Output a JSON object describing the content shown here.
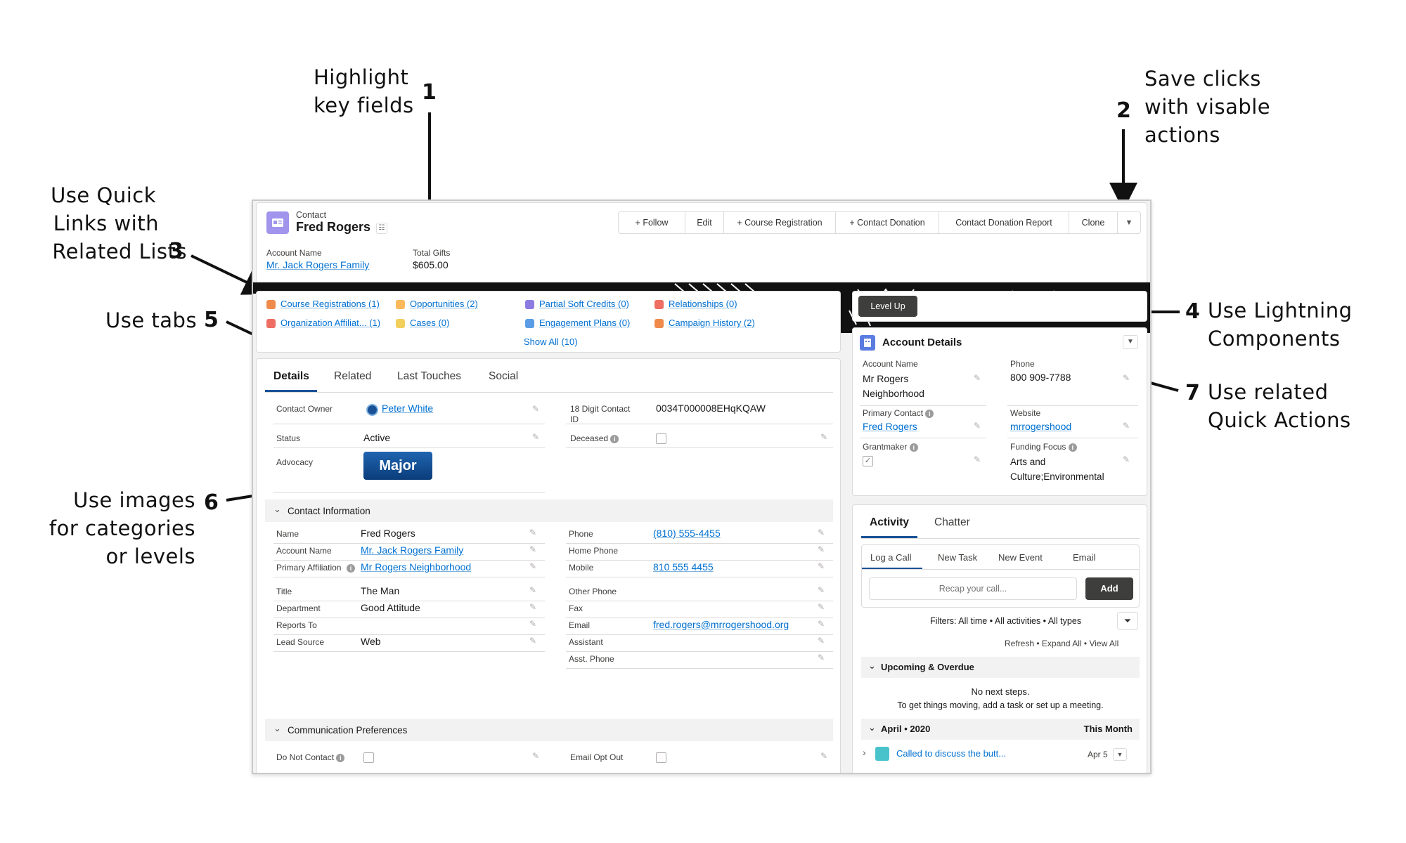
{
  "annotations": {
    "a1": {
      "lines": [
        "Highlight",
        "key fields"
      ],
      "num": "1"
    },
    "a2": {
      "lines": [
        "Save clicks",
        "with visable",
        "actions"
      ],
      "num": "2"
    },
    "a3": {
      "lines": [
        "Use Quick",
        "Links with",
        "Related Lists"
      ],
      "num": "3"
    },
    "a4": {
      "lines": [
        "Use Lightning",
        "Components"
      ],
      "num": "4"
    },
    "a5": {
      "lines": [
        "Use tabs"
      ],
      "num": "5"
    },
    "a6": {
      "lines": [
        "Use images",
        "for categories",
        "or levels"
      ],
      "num": "6"
    },
    "a7": {
      "lines": [
        "Use related",
        "Quick Actions"
      ],
      "num": "7"
    }
  },
  "header": {
    "object": "Contact",
    "name": "Fred Rogers",
    "buttons": [
      "+ Follow",
      "Edit",
      "+ Course Registration",
      "+ Contact Donation",
      "Contact Donation Report",
      "Clone"
    ],
    "fields": [
      {
        "label": "Account Name",
        "value": "Mr. Jack Rogers Family"
      },
      {
        "label": "Total Gifts",
        "value": "$605.00"
      }
    ]
  },
  "quick_links": [
    {
      "label": "Course Registrations (1)",
      "color": "#f08a4b"
    },
    {
      "label": "Opportunities (2)",
      "color": "#fcb95b"
    },
    {
      "label": "Partial Soft Credits (0)",
      "color": "#8d7be0"
    },
    {
      "label": "Relationships (0)",
      "color": "#ef6e64"
    },
    {
      "label": "Organization Affiliat... (1)",
      "color": "#ef6e64"
    },
    {
      "label": "Cases (0)",
      "color": "#f2cf5b"
    },
    {
      "label": "Engagement Plans (0)",
      "color": "#5a9ce6"
    },
    {
      "label": "Campaign History (2)",
      "color": "#f08a4b"
    }
  ],
  "quick_links_show_all": "Show All (10)",
  "tabs": [
    "Details",
    "Related",
    "Last Touches",
    "Social"
  ],
  "details": {
    "contact_owner_label": "Contact Owner",
    "contact_owner": "Peter White",
    "digit_id_label_1": "18 Digit Contact",
    "digit_id_label_2": "ID",
    "digit_id": "0034T000008EHqKQAW",
    "status_label": "Status",
    "status": "Active",
    "deceased_label": "Deceased",
    "advocacy_label": "Advocacy",
    "advocacy_badge": "Major"
  },
  "contact_info": {
    "title": "Contact Information",
    "left": [
      {
        "label": "Name",
        "value": "Fred Rogers",
        "link": false
      },
      {
        "label": "Account Name",
        "value": "Mr. Jack Rogers Family",
        "link": true
      },
      {
        "label": "Primary Affiliation",
        "value": "Mr Rogers Neighborhood",
        "link": true
      },
      {
        "label": "Title",
        "value": "The Man",
        "link": false
      },
      {
        "label": "Department",
        "value": "Good Attitude",
        "link": false
      },
      {
        "label": "Reports To",
        "value": "",
        "link": false
      },
      {
        "label": "Lead Source",
        "value": "Web",
        "link": false
      }
    ],
    "right": [
      {
        "label": "Phone",
        "value": "(810) 555-4455",
        "link": true
      },
      {
        "label": "Home Phone",
        "value": "",
        "link": false
      },
      {
        "label": "Mobile",
        "value": "810 555 4455",
        "link": true
      },
      {
        "label": "Other Phone",
        "value": "",
        "link": false
      },
      {
        "label": "Fax",
        "value": "",
        "link": false
      },
      {
        "label": "Email",
        "value": "fred.rogers@mrrogershood.org",
        "link": true
      },
      {
        "label": "Assistant",
        "value": "",
        "link": false
      },
      {
        "label": "Asst. Phone",
        "value": "",
        "link": false
      }
    ]
  },
  "comm_prefs": {
    "title": "Communication Preferences",
    "do_not_contact": "Do Not Contact",
    "email_opt_out": "Email Opt Out"
  },
  "level_up": "Level Up",
  "account_details": {
    "title": "Account Details",
    "account_name_label": "Account Name",
    "account_name_1": "Mr Rogers",
    "account_name_2": "Neighborhood",
    "phone_label": "Phone",
    "phone": "800 909-7788",
    "primary_contact_label": "Primary Contact",
    "primary_contact": "Fred Rogers",
    "website_label": "Website",
    "website": "mrrogershood",
    "grantmaker_label": "Grantmaker",
    "funding_focus_label": "Funding Focus",
    "funding_focus_1": "Arts and",
    "funding_focus_2": "Culture;Environmental"
  },
  "activity": {
    "tabs": [
      "Activity",
      "Chatter"
    ],
    "subtabs": [
      "Log a Call",
      "New Task",
      "New Event",
      "Email"
    ],
    "placeholder": "Recap your call...",
    "add": "Add",
    "filters": "Filters: All time • All activities • All types",
    "refresh": "Refresh • Expand All • View All",
    "upcoming": "Upcoming & Overdue",
    "no_steps": "No next steps.",
    "no_steps_hint": "To get things moving, add a task or set up a meeting.",
    "month": "April • 2020",
    "this_month": "This Month",
    "item": "Called to discuss the butt...",
    "item_date": "Apr 5"
  }
}
